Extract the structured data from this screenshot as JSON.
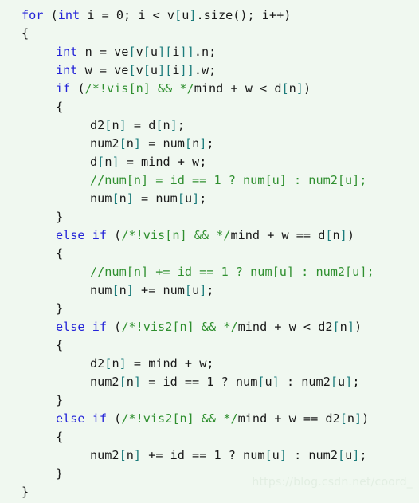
{
  "document": {
    "kind": "source-code-screenshot",
    "language": "C++",
    "background_color": "#f0f8f0",
    "watermark": "https://blog.csdn.net/coord_"
  },
  "palette": {
    "keyword": "#2424d8",
    "comment": "#2f8f2f",
    "bracket": "#1b7b7b",
    "plain": "#1a1a1a",
    "background": "#f0f8f0",
    "watermark": "#e2eee2"
  },
  "code": {
    "lines": [
      {
        "index": 1,
        "indent": 0,
        "text": "for (int i = 0; i < v[u].size(); i++)",
        "tokens": [
          {
            "t": "for",
            "c": "kw"
          },
          {
            "t": " (",
            "c": "pln"
          },
          {
            "t": "int",
            "c": "kw"
          },
          {
            "t": " i = 0; i < v",
            "c": "pln"
          },
          {
            "t": "[",
            "c": "brk"
          },
          {
            "t": "u",
            "c": "pln"
          },
          {
            "t": "]",
            "c": "brk"
          },
          {
            "t": ".size(); i++)",
            "c": "pln"
          }
        ]
      },
      {
        "index": 2,
        "indent": 0,
        "text": "{",
        "tokens": [
          {
            "t": "{",
            "c": "pln"
          }
        ]
      },
      {
        "index": 3,
        "indent": 1,
        "text": "int n = ve[v[u][i]].n;",
        "tokens": [
          {
            "t": "int",
            "c": "kw"
          },
          {
            "t": " n = ve",
            "c": "pln"
          },
          {
            "t": "[",
            "c": "brk"
          },
          {
            "t": "v",
            "c": "pln"
          },
          {
            "t": "[",
            "c": "brk"
          },
          {
            "t": "u",
            "c": "pln"
          },
          {
            "t": "]",
            "c": "brk"
          },
          {
            "t": "[",
            "c": "brk"
          },
          {
            "t": "i",
            "c": "pln"
          },
          {
            "t": "]",
            "c": "brk"
          },
          {
            "t": "]",
            "c": "brk"
          },
          {
            "t": ".n;",
            "c": "pln"
          }
        ]
      },
      {
        "index": 4,
        "indent": 1,
        "text": "int w = ve[v[u][i]].w;",
        "tokens": [
          {
            "t": "int",
            "c": "kw"
          },
          {
            "t": " w = ve",
            "c": "pln"
          },
          {
            "t": "[",
            "c": "brk"
          },
          {
            "t": "v",
            "c": "pln"
          },
          {
            "t": "[",
            "c": "brk"
          },
          {
            "t": "u",
            "c": "pln"
          },
          {
            "t": "]",
            "c": "brk"
          },
          {
            "t": "[",
            "c": "brk"
          },
          {
            "t": "i",
            "c": "pln"
          },
          {
            "t": "]",
            "c": "brk"
          },
          {
            "t": "]",
            "c": "brk"
          },
          {
            "t": ".w;",
            "c": "pln"
          }
        ]
      },
      {
        "index": 5,
        "indent": 1,
        "text": "if (/*!vis[n] && */mind + w < d[n])",
        "tokens": [
          {
            "t": "if",
            "c": "kw"
          },
          {
            "t": " (",
            "c": "pln"
          },
          {
            "t": "/*!vis[n] && */",
            "c": "com"
          },
          {
            "t": "mind + w < d",
            "c": "pln"
          },
          {
            "t": "[",
            "c": "brk"
          },
          {
            "t": "n",
            "c": "pln"
          },
          {
            "t": "]",
            "c": "brk"
          },
          {
            "t": ")",
            "c": "pln"
          }
        ]
      },
      {
        "index": 6,
        "indent": 1,
        "text": "{",
        "tokens": [
          {
            "t": "{",
            "c": "pln"
          }
        ]
      },
      {
        "index": 7,
        "indent": 2,
        "text": "d2[n] = d[n];",
        "tokens": [
          {
            "t": "d2",
            "c": "pln"
          },
          {
            "t": "[",
            "c": "brk"
          },
          {
            "t": "n",
            "c": "pln"
          },
          {
            "t": "]",
            "c": "brk"
          },
          {
            "t": " = d",
            "c": "pln"
          },
          {
            "t": "[",
            "c": "brk"
          },
          {
            "t": "n",
            "c": "pln"
          },
          {
            "t": "]",
            "c": "brk"
          },
          {
            "t": ";",
            "c": "pln"
          }
        ]
      },
      {
        "index": 8,
        "indent": 2,
        "text": "num2[n] = num[n];",
        "tokens": [
          {
            "t": "num2",
            "c": "pln"
          },
          {
            "t": "[",
            "c": "brk"
          },
          {
            "t": "n",
            "c": "pln"
          },
          {
            "t": "]",
            "c": "brk"
          },
          {
            "t": " = num",
            "c": "pln"
          },
          {
            "t": "[",
            "c": "brk"
          },
          {
            "t": "n",
            "c": "pln"
          },
          {
            "t": "]",
            "c": "brk"
          },
          {
            "t": ";",
            "c": "pln"
          }
        ]
      },
      {
        "index": 9,
        "indent": 2,
        "text": "d[n] = mind + w;",
        "tokens": [
          {
            "t": "d",
            "c": "pln"
          },
          {
            "t": "[",
            "c": "brk"
          },
          {
            "t": "n",
            "c": "pln"
          },
          {
            "t": "]",
            "c": "brk"
          },
          {
            "t": " = mind + w;",
            "c": "pln"
          }
        ]
      },
      {
        "index": 10,
        "indent": 2,
        "text": "//num[n] = id == 1 ? num[u] : num2[u];",
        "tokens": [
          {
            "t": "//num[n] = id == 1 ? num[u] : num2[u];",
            "c": "com"
          }
        ]
      },
      {
        "index": 11,
        "indent": 2,
        "text": "num[n] = num[u];",
        "tokens": [
          {
            "t": "num",
            "c": "pln"
          },
          {
            "t": "[",
            "c": "brk"
          },
          {
            "t": "n",
            "c": "pln"
          },
          {
            "t": "]",
            "c": "brk"
          },
          {
            "t": " = num",
            "c": "pln"
          },
          {
            "t": "[",
            "c": "brk"
          },
          {
            "t": "u",
            "c": "pln"
          },
          {
            "t": "]",
            "c": "brk"
          },
          {
            "t": ";",
            "c": "pln"
          }
        ]
      },
      {
        "index": 12,
        "indent": 1,
        "text": "}",
        "tokens": [
          {
            "t": "}",
            "c": "pln"
          }
        ]
      },
      {
        "index": 13,
        "indent": 1,
        "text": "else if (/*!vis[n] && */mind + w == d[n])",
        "tokens": [
          {
            "t": "else",
            "c": "kw"
          },
          {
            "t": " ",
            "c": "pln"
          },
          {
            "t": "if",
            "c": "kw"
          },
          {
            "t": " (",
            "c": "pln"
          },
          {
            "t": "/*!vis[n] && */",
            "c": "com"
          },
          {
            "t": "mind + w == d",
            "c": "pln"
          },
          {
            "t": "[",
            "c": "brk"
          },
          {
            "t": "n",
            "c": "pln"
          },
          {
            "t": "]",
            "c": "brk"
          },
          {
            "t": ")",
            "c": "pln"
          }
        ]
      },
      {
        "index": 14,
        "indent": 1,
        "text": "{",
        "tokens": [
          {
            "t": "{",
            "c": "pln"
          }
        ]
      },
      {
        "index": 15,
        "indent": 2,
        "text": "//num[n] += id == 1 ? num[u] : num2[u];",
        "tokens": [
          {
            "t": "//num[n] += id == 1 ? num[u] : num2[u];",
            "c": "com"
          }
        ]
      },
      {
        "index": 16,
        "indent": 2,
        "text": "num[n] += num[u];",
        "tokens": [
          {
            "t": "num",
            "c": "pln"
          },
          {
            "t": "[",
            "c": "brk"
          },
          {
            "t": "n",
            "c": "pln"
          },
          {
            "t": "]",
            "c": "brk"
          },
          {
            "t": " += num",
            "c": "pln"
          },
          {
            "t": "[",
            "c": "brk"
          },
          {
            "t": "u",
            "c": "pln"
          },
          {
            "t": "]",
            "c": "brk"
          },
          {
            "t": ";",
            "c": "pln"
          }
        ]
      },
      {
        "index": 17,
        "indent": 1,
        "text": "}",
        "tokens": [
          {
            "t": "}",
            "c": "pln"
          }
        ]
      },
      {
        "index": 18,
        "indent": 1,
        "text": "else if (/*!vis2[n] && */mind + w < d2[n])",
        "tokens": [
          {
            "t": "else",
            "c": "kw"
          },
          {
            "t": " ",
            "c": "pln"
          },
          {
            "t": "if",
            "c": "kw"
          },
          {
            "t": " (",
            "c": "pln"
          },
          {
            "t": "/*!vis2[n] && */",
            "c": "com"
          },
          {
            "t": "mind + w < d2",
            "c": "pln"
          },
          {
            "t": "[",
            "c": "brk"
          },
          {
            "t": "n",
            "c": "pln"
          },
          {
            "t": "]",
            "c": "brk"
          },
          {
            "t": ")",
            "c": "pln"
          }
        ]
      },
      {
        "index": 19,
        "indent": 1,
        "text": "{",
        "tokens": [
          {
            "t": "{",
            "c": "pln"
          }
        ]
      },
      {
        "index": 20,
        "indent": 2,
        "text": "d2[n] = mind + w;",
        "tokens": [
          {
            "t": "d2",
            "c": "pln"
          },
          {
            "t": "[",
            "c": "brk"
          },
          {
            "t": "n",
            "c": "pln"
          },
          {
            "t": "]",
            "c": "brk"
          },
          {
            "t": " = mind + w;",
            "c": "pln"
          }
        ]
      },
      {
        "index": 21,
        "indent": 2,
        "text": "num2[n] = id == 1 ? num[u] : num2[u];",
        "tokens": [
          {
            "t": "num2",
            "c": "pln"
          },
          {
            "t": "[",
            "c": "brk"
          },
          {
            "t": "n",
            "c": "pln"
          },
          {
            "t": "]",
            "c": "brk"
          },
          {
            "t": " = id == 1 ? num",
            "c": "pln"
          },
          {
            "t": "[",
            "c": "brk"
          },
          {
            "t": "u",
            "c": "pln"
          },
          {
            "t": "]",
            "c": "brk"
          },
          {
            "t": " : num2",
            "c": "pln"
          },
          {
            "t": "[",
            "c": "brk"
          },
          {
            "t": "u",
            "c": "pln"
          },
          {
            "t": "]",
            "c": "brk"
          },
          {
            "t": ";",
            "c": "pln"
          }
        ]
      },
      {
        "index": 22,
        "indent": 1,
        "text": "}",
        "tokens": [
          {
            "t": "}",
            "c": "pln"
          }
        ]
      },
      {
        "index": 23,
        "indent": 1,
        "text": "else if (/*!vis2[n] && */mind + w == d2[n])",
        "tokens": [
          {
            "t": "else",
            "c": "kw"
          },
          {
            "t": " ",
            "c": "pln"
          },
          {
            "t": "if",
            "c": "kw"
          },
          {
            "t": " (",
            "c": "pln"
          },
          {
            "t": "/*!vis2[n] && */",
            "c": "com"
          },
          {
            "t": "mind + w == d2",
            "c": "pln"
          },
          {
            "t": "[",
            "c": "brk"
          },
          {
            "t": "n",
            "c": "pln"
          },
          {
            "t": "]",
            "c": "brk"
          },
          {
            "t": ")",
            "c": "pln"
          }
        ]
      },
      {
        "index": 24,
        "indent": 1,
        "text": "{",
        "tokens": [
          {
            "t": "{",
            "c": "pln"
          }
        ]
      },
      {
        "index": 25,
        "indent": 2,
        "text": "num2[n] += id == 1 ? num[u] : num2[u];",
        "tokens": [
          {
            "t": "num2",
            "c": "pln"
          },
          {
            "t": "[",
            "c": "brk"
          },
          {
            "t": "n",
            "c": "pln"
          },
          {
            "t": "]",
            "c": "brk"
          },
          {
            "t": " += id == 1 ? num",
            "c": "pln"
          },
          {
            "t": "[",
            "c": "brk"
          },
          {
            "t": "u",
            "c": "pln"
          },
          {
            "t": "]",
            "c": "brk"
          },
          {
            "t": " : num2",
            "c": "pln"
          },
          {
            "t": "[",
            "c": "brk"
          },
          {
            "t": "u",
            "c": "pln"
          },
          {
            "t": "]",
            "c": "brk"
          },
          {
            "t": ";",
            "c": "pln"
          }
        ]
      },
      {
        "index": 26,
        "indent": 1,
        "text": "}",
        "tokens": [
          {
            "t": "}",
            "c": "pln"
          }
        ]
      },
      {
        "index": 27,
        "indent": 0,
        "text": "}",
        "tokens": [
          {
            "t": "}",
            "c": "pln"
          }
        ]
      }
    ]
  }
}
